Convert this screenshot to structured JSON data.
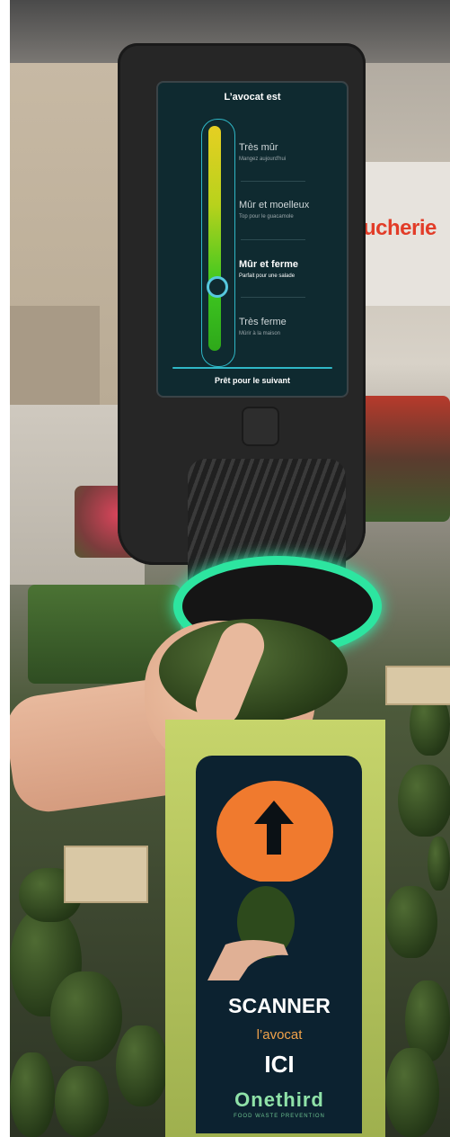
{
  "store_sign": "ucherie",
  "screen": {
    "title": "L’avocat est",
    "level": 0.72,
    "options": [
      {
        "title": "Très mûr",
        "subtitle": "Mangez aujourd'hui",
        "active": false
      },
      {
        "title": "Mûr et moelleux",
        "subtitle": "Top pour le guacamole",
        "active": false
      },
      {
        "title": "Mûr et ferme",
        "subtitle": "Parfait pour une salade",
        "active": true
      },
      {
        "title": "Très ferme",
        "subtitle": "Mûrir à la maison",
        "active": false
      }
    ],
    "footer": "Prêt pour le suivant"
  },
  "sign": {
    "line1": "SCANNER",
    "line2": "l’avocat",
    "line3": "ICI",
    "brand": "Onethird",
    "tagline": "FOOD WASTE PREVENTION"
  },
  "colors": {
    "ring": "#2de5a0",
    "screen_bg": "#0f2a30",
    "accent": "#2fb7c6",
    "sign_orange": "#f07a2e"
  }
}
